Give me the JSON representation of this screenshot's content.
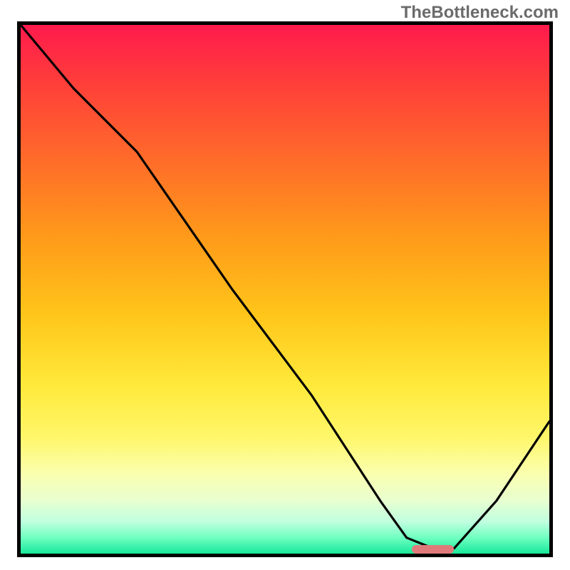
{
  "watermark": "TheBottleneck.com",
  "colors": {
    "frame": "#000000",
    "curve": "#000000",
    "marker": "#e07a7a",
    "gradient_top": "#ff1a4d",
    "gradient_bottom": "#18e89a"
  },
  "chart_data": {
    "type": "line",
    "title": "",
    "xlabel": "",
    "ylabel": "",
    "xlim": [
      0,
      100
    ],
    "ylim": [
      0,
      100
    ],
    "grid": false,
    "legend": false,
    "series": [
      {
        "name": "bottleneck-curve",
        "x": [
          0,
          10,
          22,
          40,
          55,
          68,
          73,
          78,
          82,
          90,
          100
        ],
        "y": [
          100,
          88,
          76,
          50,
          30,
          10,
          3,
          1,
          1,
          10,
          25
        ]
      }
    ],
    "optimal_marker": {
      "x_start": 74,
      "x_end": 82,
      "y": 0.8
    },
    "annotations": []
  }
}
